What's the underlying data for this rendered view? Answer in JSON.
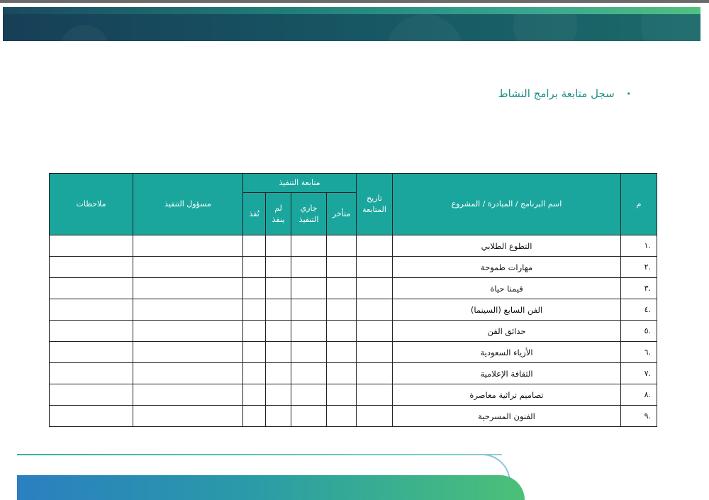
{
  "section": {
    "bullet": "•",
    "title": "سجل متابعة برامج النشاط"
  },
  "table": {
    "headers": {
      "num": "م",
      "program": "اسم البرنامج / المبادرة / المشروع",
      "follow_date": "تاريخ المتابعة",
      "execution_followup": "متابعة التنفيذ",
      "late": "متأخر",
      "in_progress": "جاري التنفيذ",
      "not_done": "لم ينفذ",
      "done": "نُفذ",
      "responsible": "مسؤول التنفيذ",
      "notes": "ملاحظات"
    },
    "rows": [
      {
        "num": ".١",
        "name": "التطوع الطلابي"
      },
      {
        "num": ".٢",
        "name": "مهارات طموحة"
      },
      {
        "num": ".٣",
        "name": "قيمنا حياة"
      },
      {
        "num": ".٤",
        "name": "الفن السابع (السينما)"
      },
      {
        "num": ".٥",
        "name": "حدائق الفن"
      },
      {
        "num": ".٦",
        "name": "الأزياء  السعودية"
      },
      {
        "num": ".٧",
        "name": "الثقافة الإعلامية"
      },
      {
        "num": ".٨",
        "name": "تصاميم تراثية معاصرة"
      },
      {
        "num": ".٩",
        "name": "الفنون المسرحية"
      }
    ]
  }
}
